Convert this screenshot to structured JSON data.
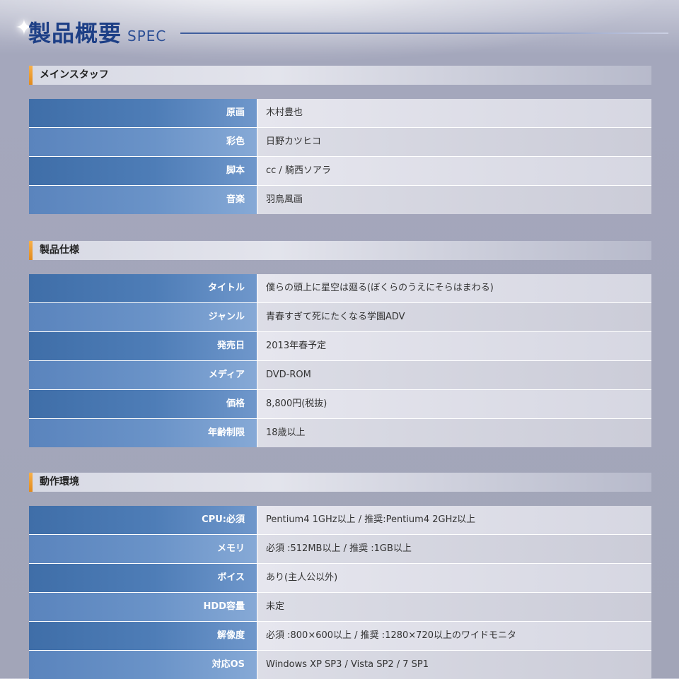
{
  "header": {
    "title": "製品概要",
    "subtitle": "SPEC"
  },
  "sections": [
    {
      "label": "メインスタッフ",
      "rows": [
        {
          "key": "原画",
          "value": "木村豊也"
        },
        {
          "key": "彩色",
          "value": "日野カツヒコ"
        },
        {
          "key": "脚本",
          "value": "cc / 騎西ソアラ"
        },
        {
          "key": "音楽",
          "value": "羽鳥風画"
        }
      ]
    },
    {
      "label": "製品仕様",
      "rows": [
        {
          "key": "タイトル",
          "value": "僕らの頭上に星空は廻る(ぼくらのうえにそらはまわる)"
        },
        {
          "key": "ジャンル",
          "value": "青春すぎて死にたくなる学園ADV"
        },
        {
          "key": "発売日",
          "value": "2013年春予定"
        },
        {
          "key": "メディア",
          "value": "DVD-ROM"
        },
        {
          "key": "価格",
          "value": "8,800円(税抜)"
        },
        {
          "key": "年齢制限",
          "value": "18歳以上"
        }
      ]
    },
    {
      "label": "動作環境",
      "rows": [
        {
          "key": "CPU:必須",
          "value": "Pentium4 1GHz以上 / 推奨:Pentium4 2GHz以上"
        },
        {
          "key": "メモリ",
          "value": "必須 :512MB以上 / 推奨 :1GB以上"
        },
        {
          "key": "ボイス",
          "value": "あり(主人公以外)"
        },
        {
          "key": "HDD容量",
          "value": "未定"
        },
        {
          "key": "解像度",
          "value": "必須 :800×600以上 / 推奨 :1280×720以上のワイドモニタ"
        },
        {
          "key": "対応OS",
          "value": "Windows XP SP3 / Vista SP2 / 7 SP1"
        }
      ]
    }
  ]
}
